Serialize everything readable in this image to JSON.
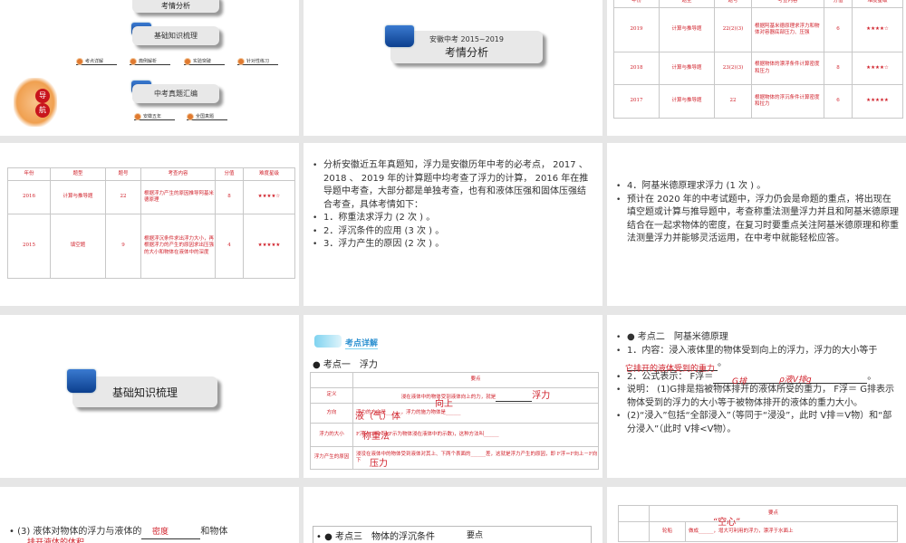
{
  "slide1": {
    "cards": [
      "考情分析",
      "基础知识梳理",
      "中考真题汇编"
    ],
    "pins_row1": [
      "考点详解",
      "典例解析",
      "实验突破",
      "针对性练习"
    ],
    "pins_row2": [
      "安徽五年",
      "全国真题"
    ],
    "logo_chars": [
      "导",
      "航"
    ]
  },
  "slide2": {
    "subtitle": "安徽中考 2015~2019",
    "title": "考情分析"
  },
  "table_headers": [
    "年份",
    "题型",
    "题号",
    "考查内容",
    "分值",
    "难度星级"
  ],
  "slide3": {
    "rows": [
      {
        "year": "2019",
        "type": "计算与推导题",
        "num": "22(2)(3)",
        "content": "根据阿基米德原理求浮力和物体对容器底部压力、压强",
        "score": "6",
        "stars": "★★★★☆"
      },
      {
        "year": "2018",
        "type": "计算与推导题",
        "num": "23(2)(3)",
        "content": "根据物体的漂浮条件计算密度和压力",
        "score": "8",
        "stars": "★★★★☆"
      },
      {
        "year": "2017",
        "type": "计算与推导题",
        "num": "22",
        "content": "根据物体的浮沉条件计算密度和拉力",
        "score": "6",
        "stars": "★★★★★"
      }
    ]
  },
  "slide4": {
    "rows": [
      {
        "year": "2016",
        "type": "计算与推导题",
        "num": "22",
        "content": "根据浮力产生的原因推导阿基米德原理",
        "score": "8",
        "stars": "★★★★☆"
      },
      {
        "year": "2015",
        "type": "填空题",
        "num": "9",
        "content": "根据浮沉条件求出浮力大小，再根据浮力的产生的原因求出压强的大小和物体在液体中的深度",
        "score": "4",
        "stars": "★★★★★"
      }
    ]
  },
  "slide5": {
    "bullets": [
      "分析安徽近五年真题知，浮力是安徽历年中考的必考点， 2017 、 2018 、 2019 年的计算题中均考查了浮力的计算， 2016 年在推导题中考查，大部分都是单独考查，也有和液体压强和固体压强结合考查，具体考情如下：",
      "1．称重法求浮力 (2 次 ) 。",
      "2．浮沉条件的应用 (3 次 ) 。",
      "3．浮力产生的原因 (2 次 ) 。"
    ]
  },
  "slide6": {
    "bullets": [
      "4．阿基米德原理求浮力 (1 次 ) 。",
      "预计在 2020 年的中考试题中，浮力仍会是命题的重点，将出现在填空题或计算与推导题中，考查称重法测量浮力并且和阿基米德原理结合在一起求物体的密度，在复习时要重点关注阿基米德原理和称重法测量浮力并能够灵活运用，在中考中就能轻松应答。"
    ]
  },
  "slide7": {
    "title": "基础知识梳理"
  },
  "slide8": {
    "banner": "考点详解",
    "heading": "● 考点一　浮力",
    "header": "要点",
    "rows": [
      {
        "label": "定义",
        "text": "浸在液体中的物体受到液体向上的力，就是",
        "answer": "浮力"
      },
      {
        "label": "方向",
        "text": "浮力的方向是______，浮力的施力物体是______",
        "answer": "向上",
        "answer2": "液（气）体"
      },
      {
        "label": "浮力的大小",
        "text": "F浮＝G－F示(F示为物体浸在液体中的示数)，这种方法叫______",
        "answer": "称重法"
      },
      {
        "label": "浮力产生的原因",
        "text": "浸没在液体中的物体受到液体对其上、下两个表面的______差，这就是浮力产生的原因，即 F浮＝F向上－F向下",
        "answer": "压力"
      }
    ]
  },
  "slide9": {
    "heading": "● 考点二　阿基米德原理",
    "line1": "1．内容：浸入液体里的物体受到向上的浮力，浮力的大小等于",
    "answer1": "它排开的液体受到的重力",
    "line2": "2．公式表示： F浮＝",
    "answer2a": "G排",
    "answer2b": "ρ液V排g",
    "line3": "说明： (1)G排是指被物体排开的液体所受的重力， F浮＝ G排表示物体受到的浮力的大小等于被物体排开的液体的重力大小。",
    "line4": "(2)“浸入”包括“全部浸入”（等同于“浸没”，此时 V排＝V物）和“部分浸入”（此时 V排<V物）。"
  },
  "slide10": {
    "text": "(3) 液体对物体的浮力与液体的",
    "answer": "密度",
    "text2": "和物体",
    "answer2": "排开液体的体积"
  },
  "slide11": {
    "heading": "● 考点三　物体的浮沉条件",
    "header": "要点"
  },
  "slide12": {
    "header": "要点",
    "label": "轮船",
    "text": "做成______，增大可利用的浮力，漂浮于水面上",
    "answer": "“空心”"
  }
}
